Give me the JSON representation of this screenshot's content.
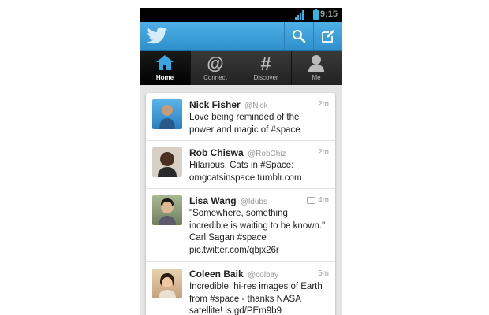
{
  "status": {
    "time": "9:15"
  },
  "actionbar": {
    "logo": "twitter-bird-icon",
    "search_icon": "search-icon",
    "compose_icon": "compose-icon"
  },
  "tabs": [
    {
      "label": "Home",
      "icon": "home-icon",
      "active": true
    },
    {
      "label": "Connect",
      "icon": "at-icon",
      "active": false
    },
    {
      "label": "Discover",
      "icon": "hash-icon",
      "active": false
    },
    {
      "label": "Me",
      "icon": "person-icon",
      "active": false
    }
  ],
  "tweets": [
    {
      "name": "Nick Fisher",
      "handle": "@Nick",
      "time": "2m",
      "text": "Love being reminded of the\npower and magic of #space"
    },
    {
      "name": "Rob Chiswa",
      "handle": "@RobChiz",
      "time": "2m",
      "text": "Hilarious. Cats in #Space:\nomgcatsinspace.tumblr.com"
    },
    {
      "name": "Lisa Wang",
      "handle": "@ldubs",
      "time": "4m",
      "text": "\"Somewhere, something\nincredible is waiting to be known.\"\nCarl Sagan #space\npic.twitter.com/qbjx26r"
    },
    {
      "name": "Coleen Baik",
      "handle": "@colbay",
      "time": "5m",
      "text": "Incredible, hi-res images of Earth\nfrom #space - thanks NASA\nsatellite! is.gd/PEm9b9"
    }
  ],
  "colors": {
    "accent": "#2e8fcb",
    "tab_bg": "#222222"
  }
}
